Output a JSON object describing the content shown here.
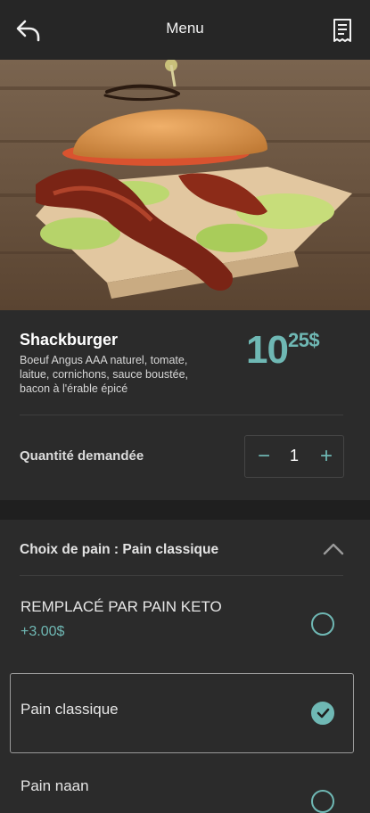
{
  "header": {
    "title": "Menu",
    "back_icon": "back-arrow-icon",
    "receipt_icon": "receipt-icon"
  },
  "product": {
    "name": "Shackburger",
    "description": "Boeuf Angus AAA naturel, tomate, laitue, cornichons, sauce boustée, bacon à l'érable épicé",
    "price_main": "10",
    "price_cents": "25$"
  },
  "quantity": {
    "label": "Quantité demandée",
    "value": "1",
    "minus": "−",
    "plus": "+"
  },
  "bread": {
    "title": "Choix de pain : Pain classique",
    "options": [
      {
        "label": "REMPLACÉ PAR PAIN KETO",
        "price": "+3.00$",
        "selected": false
      },
      {
        "label": "Pain classique",
        "price": "",
        "selected": true
      },
      {
        "label": "Pain naan",
        "price": "",
        "selected": false
      }
    ]
  },
  "colors": {
    "accent": "#6fb8b4",
    "background": "#2b2b2b",
    "topbar": "#262626"
  }
}
